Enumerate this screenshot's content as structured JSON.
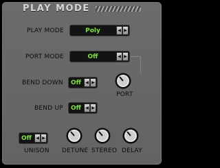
{
  "title": "PLAY MODE",
  "controls": {
    "play_mode": {
      "label": "PLAY MODE",
      "value": "Poly"
    },
    "port_mode": {
      "label": "PORT MODE",
      "value": "Off"
    },
    "bend_down": {
      "label": "BEND DOWN",
      "value": "Off"
    },
    "bend_up": {
      "label": "BEND UP",
      "value": "Off"
    },
    "unison": {
      "label": "UNISON",
      "value": "Off"
    }
  },
  "knobs": {
    "port": {
      "label": "PORT"
    },
    "detune": {
      "label": "DETUNE"
    },
    "stereo": {
      "label": "STEREO"
    },
    "delay": {
      "label": "DELAY"
    }
  },
  "arrows": {
    "left": "◀",
    "right": "▶"
  },
  "icons": [
    "arrow-left-icon",
    "arrow-right-icon",
    "knob-icon",
    "hatch-stripe-icon"
  ],
  "colors": {
    "panel": "#666666",
    "display_bg": "#131313",
    "display_text": "#7ee23a",
    "label_text": "#0c0c0c"
  }
}
